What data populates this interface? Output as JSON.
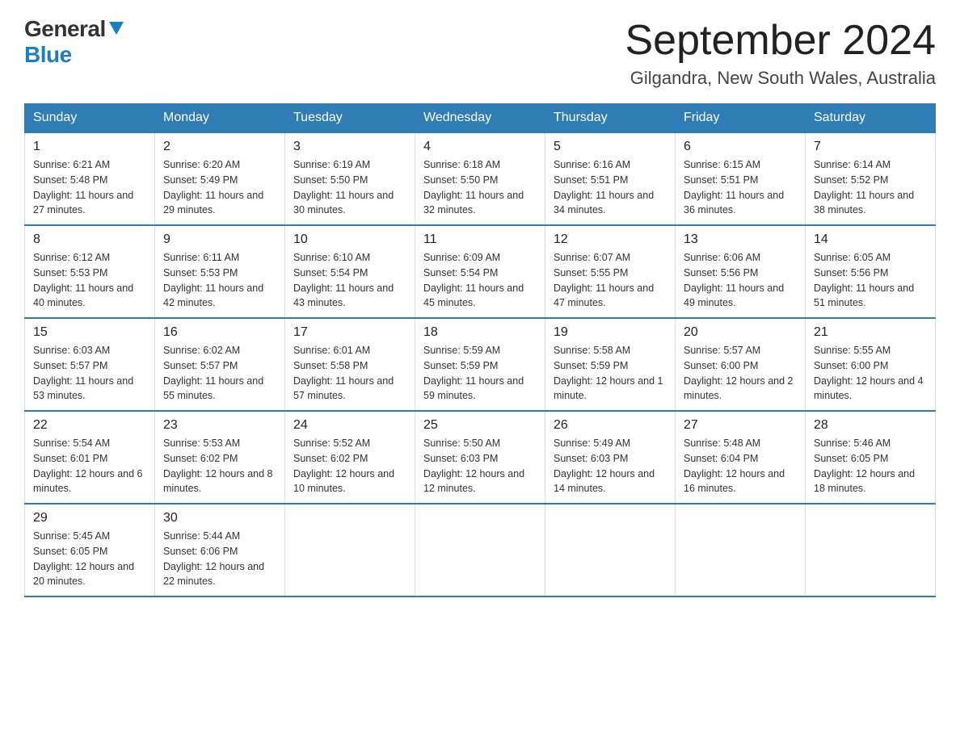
{
  "header": {
    "title": "September 2024",
    "subtitle": "Gilgandra, New South Wales, Australia",
    "logo_general": "General",
    "logo_blue": "Blue"
  },
  "days_of_week": [
    "Sunday",
    "Monday",
    "Tuesday",
    "Wednesday",
    "Thursday",
    "Friday",
    "Saturday"
  ],
  "weeks": [
    [
      {
        "day": "1",
        "sunrise": "6:21 AM",
        "sunset": "5:48 PM",
        "daylight": "11 hours and 27 minutes."
      },
      {
        "day": "2",
        "sunrise": "6:20 AM",
        "sunset": "5:49 PM",
        "daylight": "11 hours and 29 minutes."
      },
      {
        "day": "3",
        "sunrise": "6:19 AM",
        "sunset": "5:50 PM",
        "daylight": "11 hours and 30 minutes."
      },
      {
        "day": "4",
        "sunrise": "6:18 AM",
        "sunset": "5:50 PM",
        "daylight": "11 hours and 32 minutes."
      },
      {
        "day": "5",
        "sunrise": "6:16 AM",
        "sunset": "5:51 PM",
        "daylight": "11 hours and 34 minutes."
      },
      {
        "day": "6",
        "sunrise": "6:15 AM",
        "sunset": "5:51 PM",
        "daylight": "11 hours and 36 minutes."
      },
      {
        "day": "7",
        "sunrise": "6:14 AM",
        "sunset": "5:52 PM",
        "daylight": "11 hours and 38 minutes."
      }
    ],
    [
      {
        "day": "8",
        "sunrise": "6:12 AM",
        "sunset": "5:53 PM",
        "daylight": "11 hours and 40 minutes."
      },
      {
        "day": "9",
        "sunrise": "6:11 AM",
        "sunset": "5:53 PM",
        "daylight": "11 hours and 42 minutes."
      },
      {
        "day": "10",
        "sunrise": "6:10 AM",
        "sunset": "5:54 PM",
        "daylight": "11 hours and 43 minutes."
      },
      {
        "day": "11",
        "sunrise": "6:09 AM",
        "sunset": "5:54 PM",
        "daylight": "11 hours and 45 minutes."
      },
      {
        "day": "12",
        "sunrise": "6:07 AM",
        "sunset": "5:55 PM",
        "daylight": "11 hours and 47 minutes."
      },
      {
        "day": "13",
        "sunrise": "6:06 AM",
        "sunset": "5:56 PM",
        "daylight": "11 hours and 49 minutes."
      },
      {
        "day": "14",
        "sunrise": "6:05 AM",
        "sunset": "5:56 PM",
        "daylight": "11 hours and 51 minutes."
      }
    ],
    [
      {
        "day": "15",
        "sunrise": "6:03 AM",
        "sunset": "5:57 PM",
        "daylight": "11 hours and 53 minutes."
      },
      {
        "day": "16",
        "sunrise": "6:02 AM",
        "sunset": "5:57 PM",
        "daylight": "11 hours and 55 minutes."
      },
      {
        "day": "17",
        "sunrise": "6:01 AM",
        "sunset": "5:58 PM",
        "daylight": "11 hours and 57 minutes."
      },
      {
        "day": "18",
        "sunrise": "5:59 AM",
        "sunset": "5:59 PM",
        "daylight": "11 hours and 59 minutes."
      },
      {
        "day": "19",
        "sunrise": "5:58 AM",
        "sunset": "5:59 PM",
        "daylight": "12 hours and 1 minute."
      },
      {
        "day": "20",
        "sunrise": "5:57 AM",
        "sunset": "6:00 PM",
        "daylight": "12 hours and 2 minutes."
      },
      {
        "day": "21",
        "sunrise": "5:55 AM",
        "sunset": "6:00 PM",
        "daylight": "12 hours and 4 minutes."
      }
    ],
    [
      {
        "day": "22",
        "sunrise": "5:54 AM",
        "sunset": "6:01 PM",
        "daylight": "12 hours and 6 minutes."
      },
      {
        "day": "23",
        "sunrise": "5:53 AM",
        "sunset": "6:02 PM",
        "daylight": "12 hours and 8 minutes."
      },
      {
        "day": "24",
        "sunrise": "5:52 AM",
        "sunset": "6:02 PM",
        "daylight": "12 hours and 10 minutes."
      },
      {
        "day": "25",
        "sunrise": "5:50 AM",
        "sunset": "6:03 PM",
        "daylight": "12 hours and 12 minutes."
      },
      {
        "day": "26",
        "sunrise": "5:49 AM",
        "sunset": "6:03 PM",
        "daylight": "12 hours and 14 minutes."
      },
      {
        "day": "27",
        "sunrise": "5:48 AM",
        "sunset": "6:04 PM",
        "daylight": "12 hours and 16 minutes."
      },
      {
        "day": "28",
        "sunrise": "5:46 AM",
        "sunset": "6:05 PM",
        "daylight": "12 hours and 18 minutes."
      }
    ],
    [
      {
        "day": "29",
        "sunrise": "5:45 AM",
        "sunset": "6:05 PM",
        "daylight": "12 hours and 20 minutes."
      },
      {
        "day": "30",
        "sunrise": "5:44 AM",
        "sunset": "6:06 PM",
        "daylight": "12 hours and 22 minutes."
      },
      null,
      null,
      null,
      null,
      null
    ]
  ],
  "labels": {
    "sunrise": "Sunrise:",
    "sunset": "Sunset:",
    "daylight": "Daylight:"
  },
  "colors": {
    "header_bg": "#2e7db5",
    "accent": "#1a7fc1"
  }
}
